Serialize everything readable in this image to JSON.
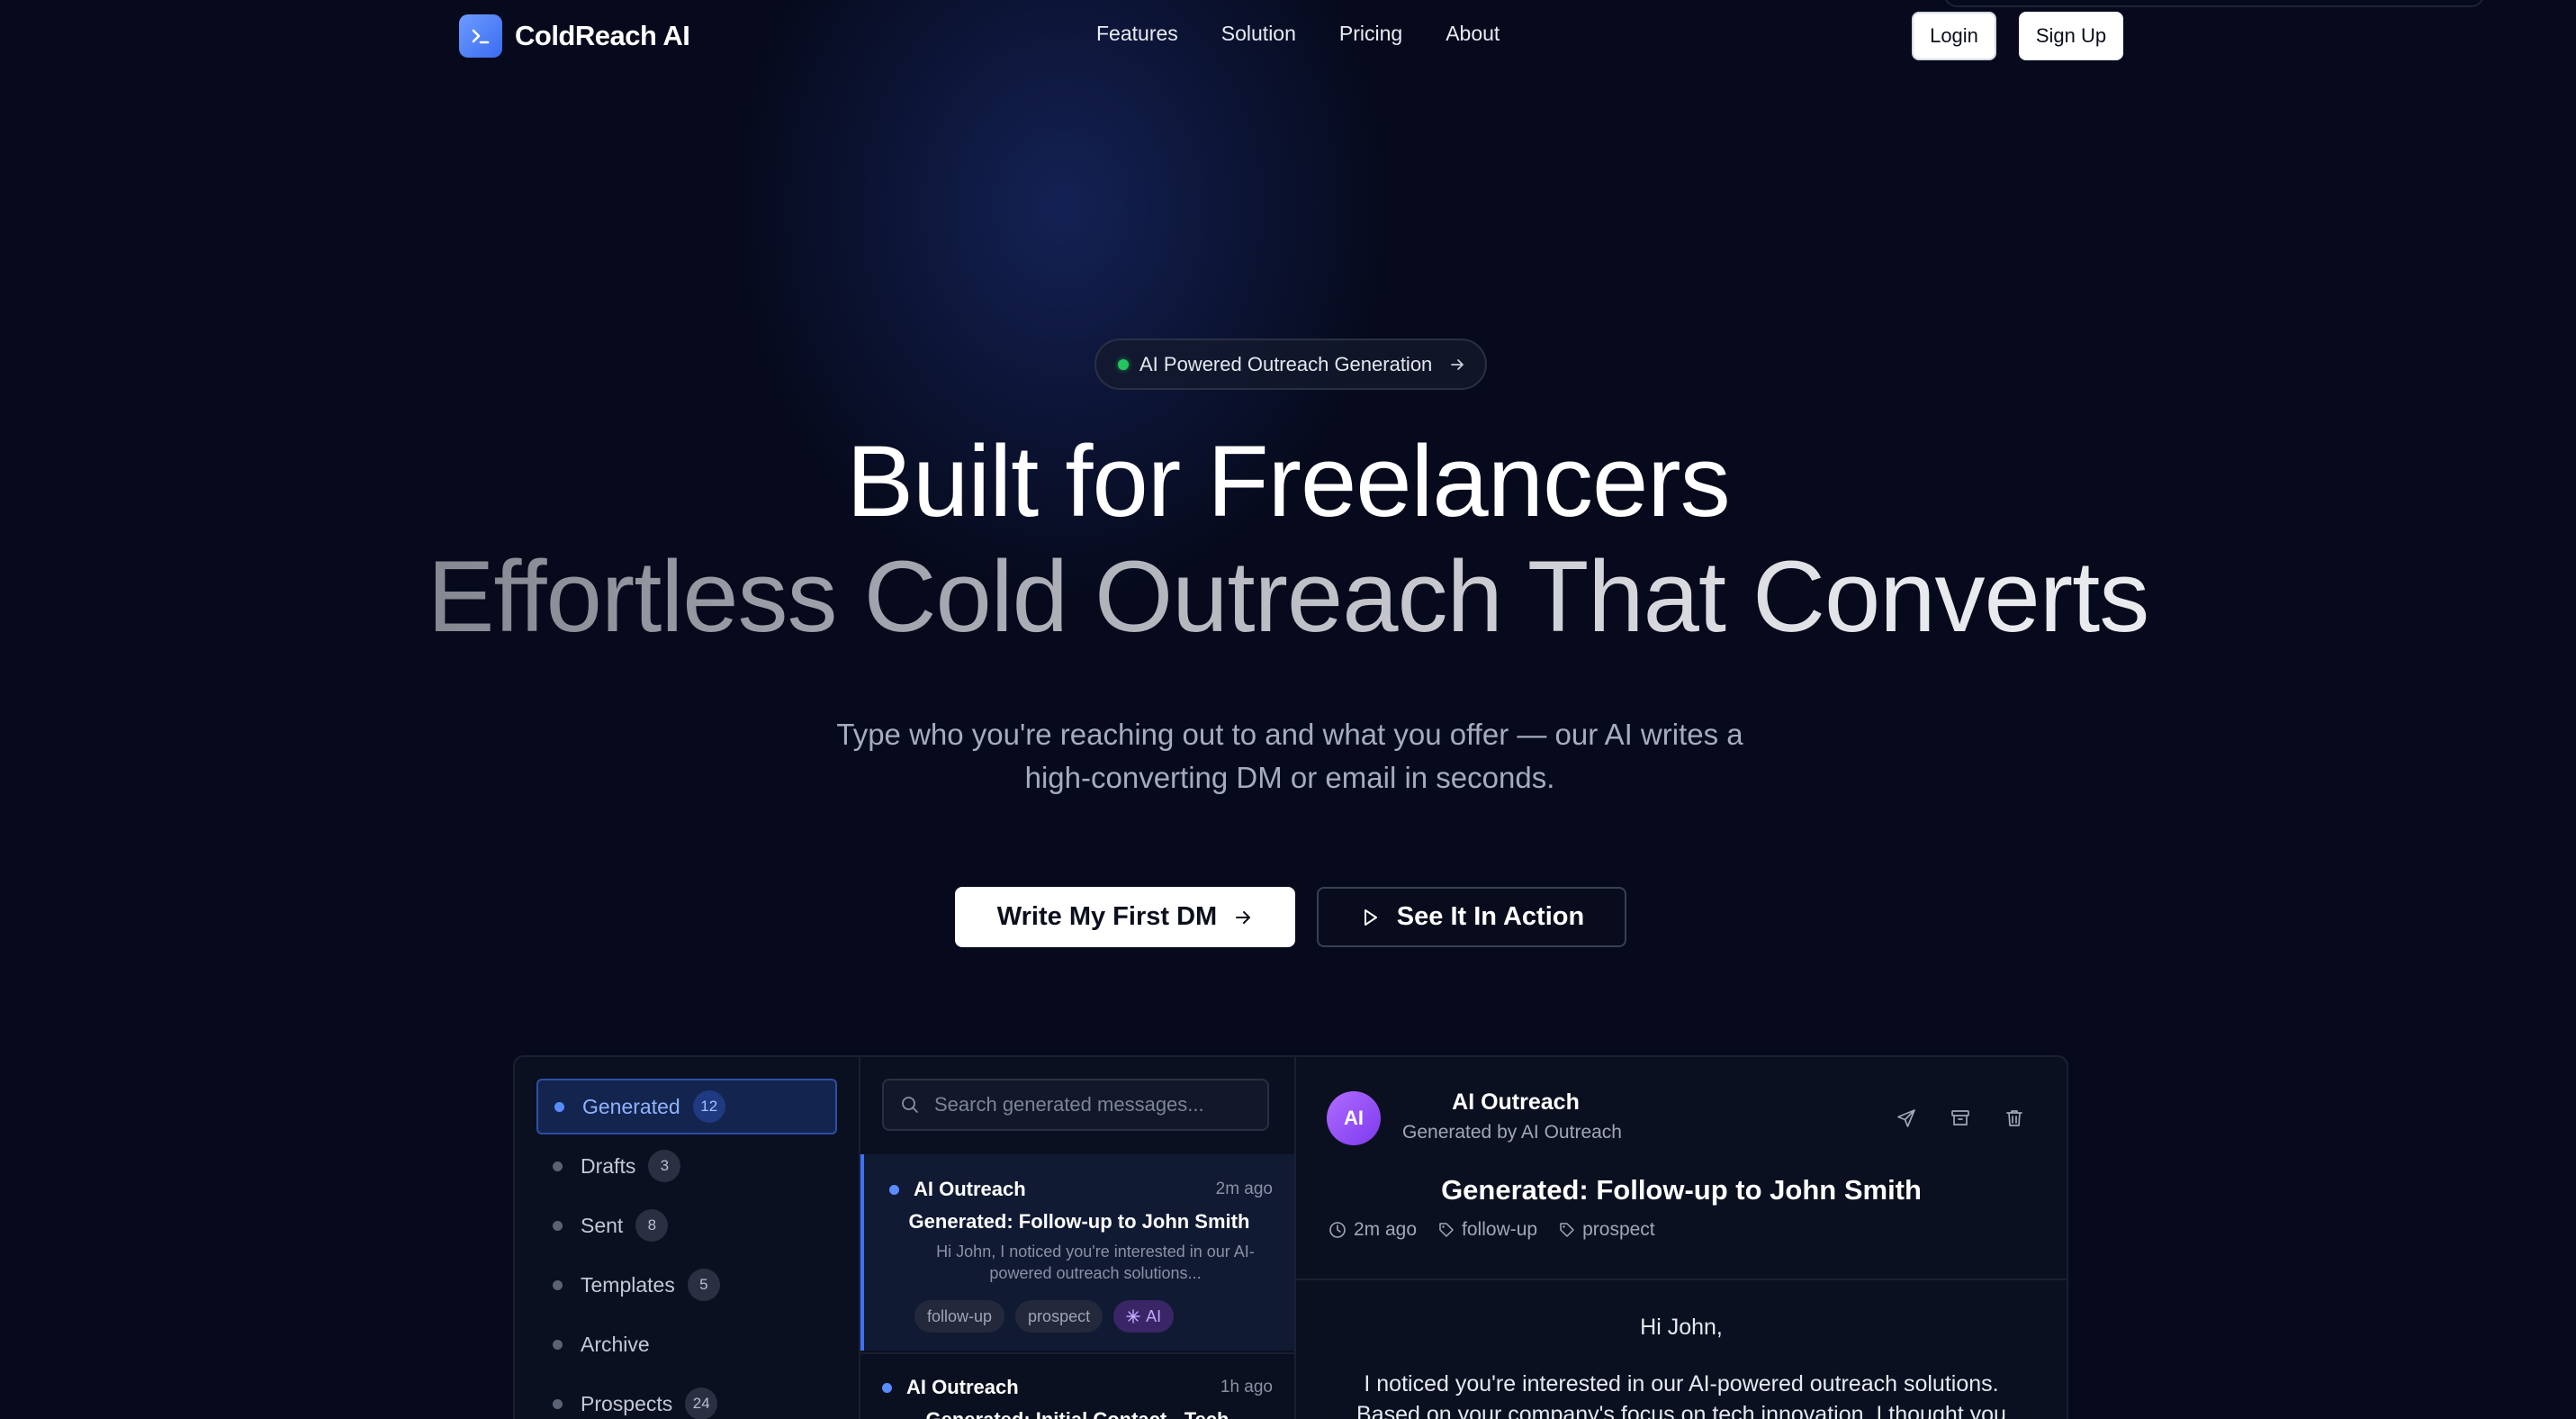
{
  "brand": {
    "name": "ColdReach AI",
    "logo_icon": "terminal-prompt-icon",
    "accent": "#4d7df5"
  },
  "nav": {
    "links": [
      "Features",
      "Solution",
      "Pricing",
      "About"
    ],
    "login_label": "Login",
    "signup_label": "Sign Up"
  },
  "hero": {
    "badge_text": "AI Powered Outreach Generation",
    "title": "Built for Freelancers",
    "subtitle": "Effortless Cold Outreach That Converts",
    "description": "Type who you're reaching out to and what you offer — our AI writes a high-converting DM or email in seconds.",
    "primary_cta": "Write My First DM",
    "secondary_cta": "See It In Action"
  },
  "app": {
    "sidebar": [
      {
        "label": "Generated",
        "count": "12",
        "active": true
      },
      {
        "label": "Drafts",
        "count": "3"
      },
      {
        "label": "Sent",
        "count": "8"
      },
      {
        "label": "Templates",
        "count": "5"
      },
      {
        "label": "Archive",
        "count": ""
      },
      {
        "label": "Prospects",
        "count": "24"
      }
    ],
    "search_placeholder": "Search generated messages...",
    "messages": [
      {
        "from": "AI Outreach",
        "time": "2m ago",
        "subject": "Generated: Follow-up to John Smith",
        "preview": "Hi John, I noticed you're interested in our AI-powered outreach solutions...",
        "tags": [
          "follow-up",
          "prospect",
          "AI"
        ]
      },
      {
        "from": "AI Outreach",
        "time": "1h ago",
        "subject": "Generated: Initial Contact - Tech"
      }
    ],
    "detail": {
      "avatar_initials": "AI",
      "from": "AI Outreach",
      "by": "Generated by AI Outreach",
      "subject": "Generated: Follow-up to John Smith",
      "time": "2m ago",
      "tags": [
        "follow-up",
        "prospect"
      ],
      "greeting": "Hi John,",
      "body": "I noticed you're interested in our AI-powered outreach solutions. Based on your company's focus on tech innovation, I thought you"
    }
  }
}
